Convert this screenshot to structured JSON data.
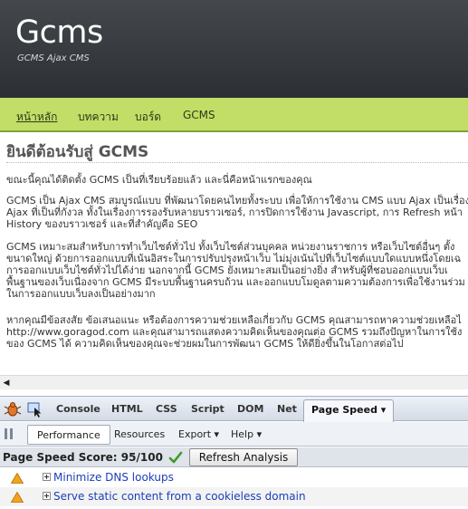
{
  "site": {
    "title": "Gcms",
    "subtitle": "GCMS Ajax CMS"
  },
  "nav": {
    "items": [
      {
        "label": "หน้าหลัก",
        "active": true
      },
      {
        "label": "บทความ",
        "active": false
      },
      {
        "label": "บอร์ด",
        "active": false
      },
      {
        "label": "GCMS",
        "active": false
      }
    ]
  },
  "content": {
    "heading": "ยินดีต้อนรับสู่ GCMS",
    "paragraphs": [
      [
        "ขณะนี้คุณได้ติดตั้ง GCMS เป็นที่เรียบร้อยแล้ว และนี่คือหน้าแรกของคุณ"
      ],
      [
        "GCMS เป็น Ajax CMS สมบูรณ์แบบ ที่พัฒนาโดยคนไทยทั้งระบบ เพื่อให้การใช้งาน CMS แบบ Ajax เป็นเรื่อง",
        "Ajax ที่เป็นที่กังวล ทั้งในเรื่องการรองรับหลายบราวเซอร์, การปิดการใช้งาน Javascript, การ Refresh หน้า",
        "History ของบราวเซอร์ และที่สำคัญคือ SEO"
      ],
      [
        "GCMS เหมาะสมสำหรับการทำเว็บไซต์ทั่วไป ทั้งเว็บไซต์ส่วนบุคคล หน่วยงานราชการ หรือเว็บไซต์อื่นๆ ตั้ง",
        "ขนาดใหญ่ ด้วยการออกแบบที่เน้นอิสระในการปรับปรุงหน้าเว็บ ไม่มุ่งเน้นไปที่เว็บไซต์แบบใดแบบหนึ่งโดยเฉ",
        "การออกแบบเว็บไซต์ทั่วไปได้ง่าย นอกจากนี้ GCMS ยังเหมาะสมเป็นอย่างยิ่ง สำหรับผู้ที่ชอบออกแบบเว็บเ",
        "พื้นฐานของเว็บเนื่องจาก GCMS มีระบบพื้นฐานครบถ้วน และออกแบบโมดูลตามความต้องการเพื่อใช้งานร่วม",
        "ในการออกแบบเว็บลงเป็นอย่างมาก"
      ],
      [
        "หากคุณมีข้อสงสัย ข้อเสนอแนะ หรือต้องการความช่วยเหลือเกี่ยวกับ GCMS คุณสามารถหาความช่วยเหลือไ",
        "http://www.goragod.com และคุณสามารถแสดงความคิดเห็นของคุณต่อ GCMS รวมถึงปัญหาในการใช้ง",
        "ของ GCMS ได้ ความคิดเห็นของคุณจะช่วยผมในการพัฒนา GCMS ให้ดียิ่งขึ้นในโอกาสต่อไป"
      ]
    ]
  },
  "firebug": {
    "tabs": [
      "Console",
      "HTML",
      "CSS",
      "Script",
      "DOM",
      "Net",
      "Page Speed ▾"
    ],
    "subtabs": [
      "Performance",
      "Resources",
      "Export ▾",
      "Help ▾"
    ],
    "score_label": "Page Speed Score: 95/100",
    "refresh_label": "Refresh Analysis",
    "rules": [
      "Minimize DNS lookups",
      "Serve static content from a cookieless domain"
    ]
  }
}
